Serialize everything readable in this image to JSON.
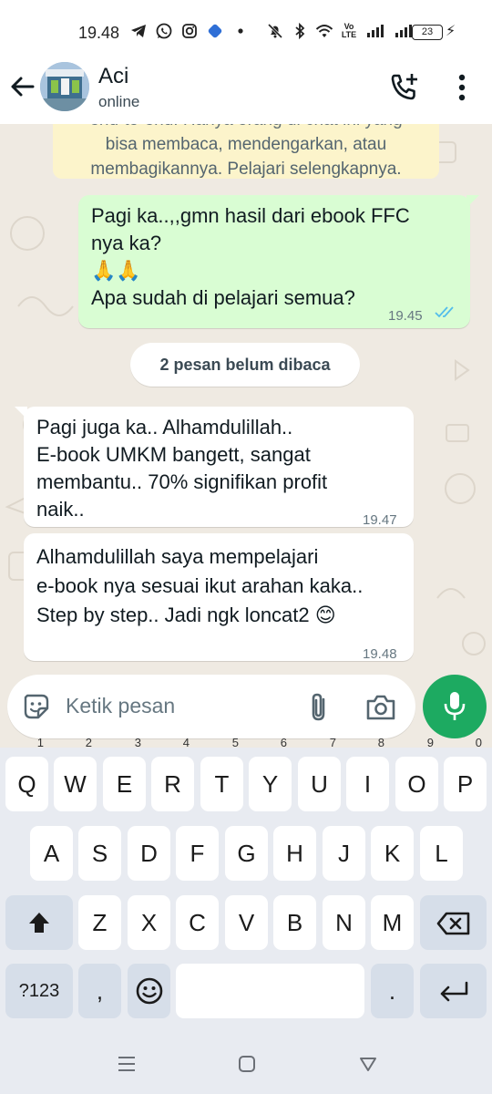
{
  "status_bar": {
    "time": "19.48",
    "volte": "Vo\nLTE",
    "battery": "23"
  },
  "header": {
    "contact_name": "Aci",
    "contact_status": "online"
  },
  "chat": {
    "encryption_line0": "end-to-end. Hanya orang di chat ini yang",
    "encryption_line1": "bisa membaca, mendengarkan, atau",
    "encryption_line2": "membagikannya. Pelajari selengkapnya.",
    "messages": [
      {
        "direction": "out",
        "text": "Pagi ka..,,gmn hasil dari ebook FFC\nnya ka?\n🙏🙏\nApa sudah di pelajari semua?",
        "time": "19.45"
      },
      {
        "direction": "in",
        "text": "Pagi juga ka.. Alhamdulillah..\nE-book UMKM bangett, sangat\nmembantu.. 70% signifikan profit\nnaik..",
        "time": "19.47"
      },
      {
        "direction": "in",
        "text": "Alhamdulillah saya mempelajari\ne-book nya sesuai ikut arahan kaka..\nStep by step.. Jadi ngk loncat2 😊",
        "time": "19.48"
      }
    ],
    "unread_label": "2 pesan belum dibaca"
  },
  "input": {
    "placeholder": "Ketik pesan"
  },
  "keyboard": {
    "row1": [
      {
        "key": "Q",
        "hint": "1"
      },
      {
        "key": "W",
        "hint": "2"
      },
      {
        "key": "E",
        "hint": "3"
      },
      {
        "key": "R",
        "hint": "4"
      },
      {
        "key": "T",
        "hint": "5"
      },
      {
        "key": "Y",
        "hint": "6"
      },
      {
        "key": "U",
        "hint": "7"
      },
      {
        "key": "I",
        "hint": "8"
      },
      {
        "key": "O",
        "hint": "9"
      },
      {
        "key": "P",
        "hint": "0"
      }
    ],
    "row2": [
      "A",
      "S",
      "D",
      "F",
      "G",
      "H",
      "J",
      "K",
      "L"
    ],
    "row3": [
      "Z",
      "X",
      "C",
      "V",
      "B",
      "N",
      "M"
    ],
    "sym_label": "?123",
    "comma": ",",
    "period": "."
  },
  "colors": {
    "outgoing_bubble": "#d9fdd3",
    "incoming_bubble": "#ffffff",
    "accent_green": "#1daa61",
    "read_ticks": "#53bdeb",
    "encryption_notice": "#fcf4cb",
    "chat_background": "#efeae2"
  },
  "icons": {
    "status_left": [
      "telegram-icon",
      "whatsapp-icon",
      "instagram-icon",
      "blue-app-icon",
      "dot-icon"
    ],
    "status_right": [
      "mute-icon",
      "bluetooth-icon",
      "wifi-icon",
      "volte-icon",
      "signal-icon",
      "signal-icon",
      "battery-icon",
      "charging-icon"
    ],
    "header": [
      "back-arrow-icon",
      "add-call-icon",
      "more-vert-icon"
    ],
    "input": [
      "sticker-icon",
      "attach-icon",
      "camera-icon",
      "mic-icon"
    ],
    "keyboard": [
      "shift-icon",
      "backspace-icon",
      "emoji-icon",
      "enter-icon"
    ],
    "nav": [
      "recents-icon",
      "home-icon",
      "back-icon"
    ]
  }
}
